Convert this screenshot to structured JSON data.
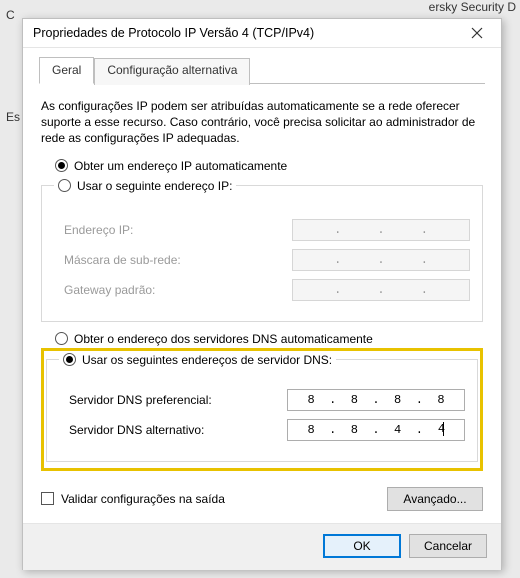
{
  "bg": {
    "top_right": "ersky Security D",
    "left1": "C",
    "left2": "Es"
  },
  "dialog": {
    "title": "Propriedades de Protocolo IP Versão 4 (TCP/IPv4)",
    "tabs": {
      "general": "Geral",
      "alt": "Configuração alternativa"
    },
    "description": "As configurações IP podem ser atribuídas automaticamente se a rede oferecer suporte a esse recurso. Caso contrário, você precisa solicitar ao administrador de rede as configurações IP adequadas.",
    "ip_section": {
      "radio_auto": "Obter um endereço IP automaticamente",
      "radio_manual": "Usar o seguinte endereço IP:",
      "fields": {
        "ip_label": "Endereço IP:",
        "mask_label": "Máscara de sub-rede:",
        "gw_label": "Gateway padrão:"
      }
    },
    "dns_section": {
      "radio_auto": "Obter o endereço dos servidores DNS automaticamente",
      "radio_manual": "Usar os seguintes endereços de servidor DNS:",
      "pref_label": "Servidor DNS preferencial:",
      "alt_label": "Servidor DNS alternativo:",
      "pref_value": {
        "o1": "8",
        "o2": "8",
        "o3": "8",
        "o4": "8"
      },
      "alt_value": {
        "o1": "8",
        "o2": "8",
        "o3": "4",
        "o4": "4"
      }
    },
    "validate_label": "Validar configurações na saída",
    "advanced_label": "Avançado...",
    "ok_label": "OK",
    "cancel_label": "Cancelar"
  }
}
